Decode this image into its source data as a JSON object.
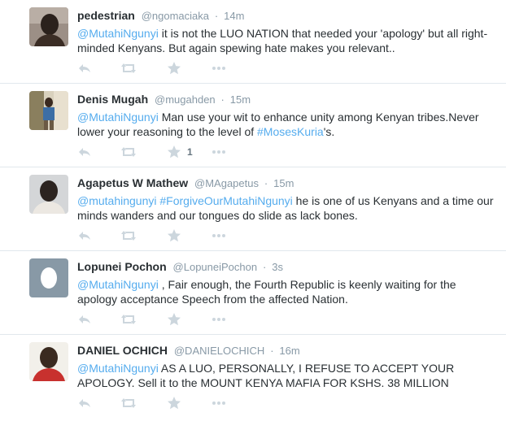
{
  "tweets": [
    {
      "name": "pedestrian",
      "handle": "@ngomaciaka",
      "sep": "·",
      "time": "14m",
      "text": [
        {
          "t": "@MutahiNgunyi",
          "link": true
        },
        {
          "t": " it is not the LUO NATION that needed your 'apology' but all right-minded Kenyans. But again  spewing hate makes you relevant..",
          "link": false
        }
      ],
      "favorite_count": "",
      "avatar": "dark-portrait"
    },
    {
      "name": "Denis Mugah",
      "handle": "@mugahden",
      "sep": "·",
      "time": "15m",
      "text": [
        {
          "t": "@MutahiNgunyi",
          "link": true
        },
        {
          "t": " Man use your wit to enhance unity among Kenyan tribes.Never lower your reasoning to the level of ",
          "link": false
        },
        {
          "t": "#MosesKuria",
          "link": true
        },
        {
          "t": "'s.",
          "link": false
        }
      ],
      "favorite_count": "1",
      "avatar": "outdoor-portrait"
    },
    {
      "name": "Agapetus W Mathew",
      "handle": "@MAgapetus",
      "sep": "·",
      "time": "15m",
      "text": [
        {
          "t": "@mutahingunyi",
          "link": true
        },
        {
          "t": " ",
          "link": false
        },
        {
          "t": "#ForgiveOurMutahiNgunyi",
          "link": true
        },
        {
          "t": " he is one of us Kenyans and a time our minds wanders and our tongues do slide as lack bones.",
          "link": false
        }
      ],
      "favorite_count": "",
      "avatar": "bald-portrait"
    },
    {
      "name": "Lopunei Pochon",
      "handle": "@LopuneiPochon",
      "sep": "·",
      "time": "3s",
      "text": [
        {
          "t": "@MutahiNgunyi",
          "link": true
        },
        {
          "t": " , Fair enough, the Fourth Republic is keenly waiting for the apology acceptance Speech from the affected Nation.",
          "link": false
        }
      ],
      "favorite_count": "",
      "avatar": "default-egg"
    },
    {
      "name": "DANIEL OCHICH",
      "handle": "@DANIELOCHICH",
      "sep": "·",
      "time": "16m",
      "text": [
        {
          "t": "@MutahiNgunyi",
          "link": true
        },
        {
          "t": " AS A LUO, PERSONALLY, I REFUSE TO ACCEPT YOUR APOLOGY. Sell it to the MOUNT KENYA MAFIA FOR KSHS. 38 MILLION",
          "link": false
        }
      ],
      "favorite_count": "",
      "avatar": "red-shirt-portrait"
    }
  ],
  "icons": {
    "reply": "reply-icon",
    "retweet": "retweet-icon",
    "favorite": "star-icon",
    "more": "more-icon"
  },
  "colors": {
    "link": "#55acee",
    "icon": "#ccd6dd",
    "meta": "#8899a6",
    "text": "#292f33",
    "divider": "#e1e8ed"
  }
}
